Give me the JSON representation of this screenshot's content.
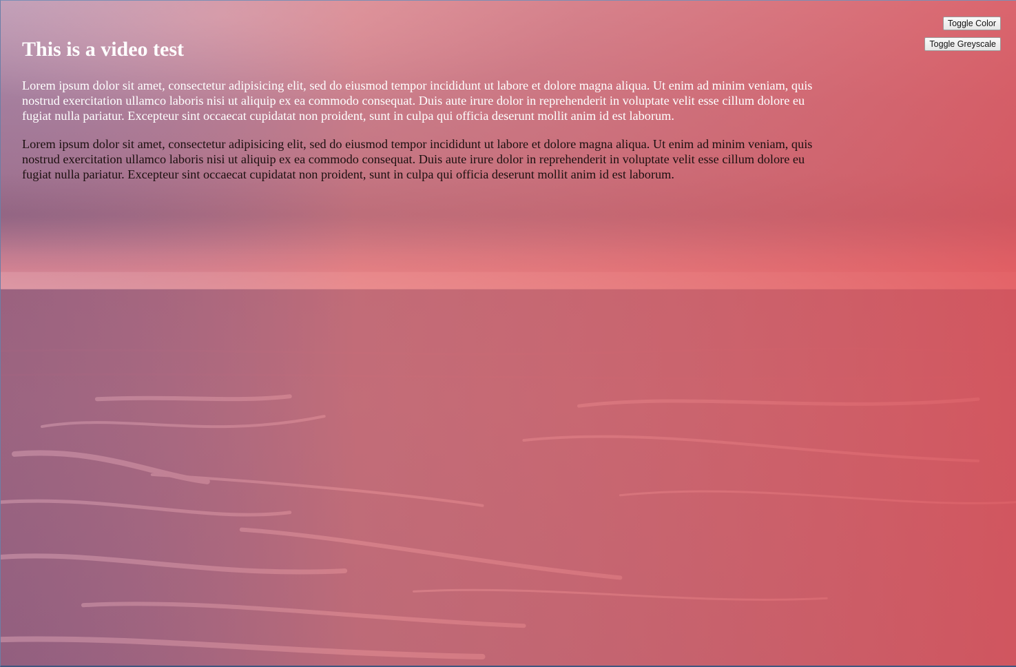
{
  "page": {
    "heading": "This is a video test",
    "paragraphs": [
      "Lorem ipsum dolor sit amet, consectetur adipisicing elit, sed do eiusmod tempor incididunt ut labore et dolore magna aliqua. Ut enim ad minim veniam, quis nostrud exercitation ullamco laboris nisi ut aliquip ex ea commodo consequat. Duis aute irure dolor in reprehenderit in voluptate velit esse cillum dolore eu fugiat nulla pariatur. Excepteur sint occaecat cupidatat non proident, sunt in culpa qui officia deserunt mollit anim id est laborum.",
      "Lorem ipsum dolor sit amet, consectetur adipisicing elit, sed do eiusmod tempor incididunt ut labore et dolore magna aliqua. Ut enim ad minim veniam, quis nostrud exercitation ullamco laboris nisi ut aliquip ex ea commodo consequat. Duis aute irure dolor in reprehenderit in voluptate velit esse cillum dolore eu fugiat nulla pariatur. Excepteur sint occaecat cupidatat non proident, sunt in culpa qui officia deserunt mollit anim id est laborum."
    ]
  },
  "controls": {
    "toggle_color_label": "Toggle Color",
    "toggle_greyscale_label": "Toggle Greyscale"
  },
  "colors": {
    "overlay_tint": "#e0605f",
    "sky_top": "#c7a6bf",
    "horizon_glow": "#f0a0a0",
    "sea": "#b25868",
    "foam": "#e7a2ae"
  }
}
